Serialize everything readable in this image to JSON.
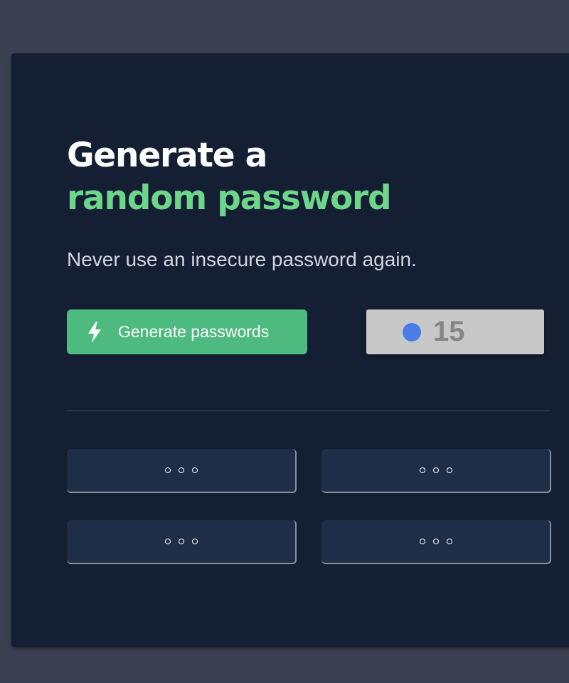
{
  "hero": {
    "title_line1": "Generate a",
    "title_line2": "random password",
    "subtitle": "Never use an insecure password again."
  },
  "controls": {
    "generate_label": "Generate passwords",
    "generate_icon": "lightning-bolt-icon",
    "length_value": "15",
    "length_thumb_color": "#4a7de8"
  },
  "passwords": [
    {
      "placeholder_icon": "ellipsis-icon"
    },
    {
      "placeholder_icon": "ellipsis-icon"
    },
    {
      "placeholder_icon": "ellipsis-icon"
    },
    {
      "placeholder_icon": "ellipsis-icon"
    }
  ],
  "colors": {
    "background": "#3b4150",
    "card": "#141f33",
    "accent": "#6dd68a",
    "button": "#4dba80",
    "password_box": "#1f2e48"
  }
}
